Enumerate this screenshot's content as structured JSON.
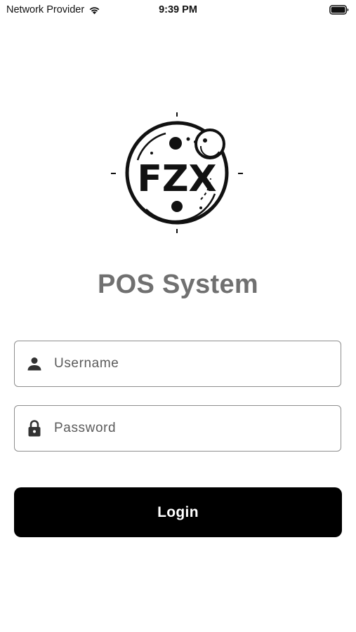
{
  "status_bar": {
    "carrier": "Network Provider",
    "time": "9:39 PM",
    "icons": [
      "wifi-icon",
      "battery-icon"
    ]
  },
  "logo": {
    "text": "FZX"
  },
  "title": "POS System",
  "username": {
    "icon": "person-icon",
    "placeholder": "Username",
    "value": ""
  },
  "password": {
    "icon": "lock-icon",
    "placeholder": "Password",
    "value": ""
  },
  "login_button": {
    "label": "Login"
  },
  "colors": {
    "background": "#ffffff",
    "title": "#707070",
    "button_bg": "#000000",
    "button_text": "#ffffff",
    "field_border": "#8e8e8e",
    "icon": "#333333"
  }
}
